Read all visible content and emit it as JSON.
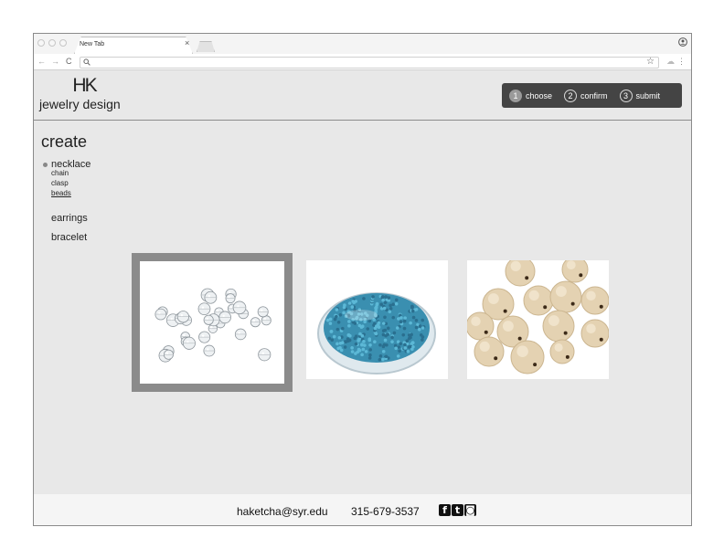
{
  "browser": {
    "tab_title": "New Tab",
    "icons": [
      "close-icon",
      "back-icon",
      "forward-icon",
      "reload-icon",
      "search-icon",
      "star-icon",
      "extension-icon",
      "menu-icon",
      "profile-icon"
    ]
  },
  "brand": {
    "logo_mark": "HK",
    "name": "jewelry design"
  },
  "steps": [
    {
      "number": "1",
      "label": "choose",
      "active": true
    },
    {
      "number": "2",
      "label": "confirm",
      "active": false
    },
    {
      "number": "3",
      "label": "submit",
      "active": false
    }
  ],
  "sidebar": {
    "heading": "create",
    "menu": {
      "necklace": "necklace",
      "chain": "chain",
      "clasp": "clasp",
      "beads": "beads",
      "earrings": "earrings",
      "bracelet": "bracelet"
    }
  },
  "products": [
    {
      "kind": "clear-crystal-beads",
      "selected": true
    },
    {
      "kind": "blue-seed-beads",
      "selected": false
    },
    {
      "kind": "wooden-beads",
      "selected": false
    }
  ],
  "footer": {
    "email": "haketcha@syr.edu",
    "phone": "315-679-3537",
    "social": {
      "facebook": "f",
      "twitter": "t",
      "instagram": "◙"
    }
  },
  "colors": {
    "page_bg": "#e8e8e8",
    "steps_bg": "#444444",
    "selected_border": "#8b8b8b",
    "footer_bg": "#f5f5f5"
  }
}
